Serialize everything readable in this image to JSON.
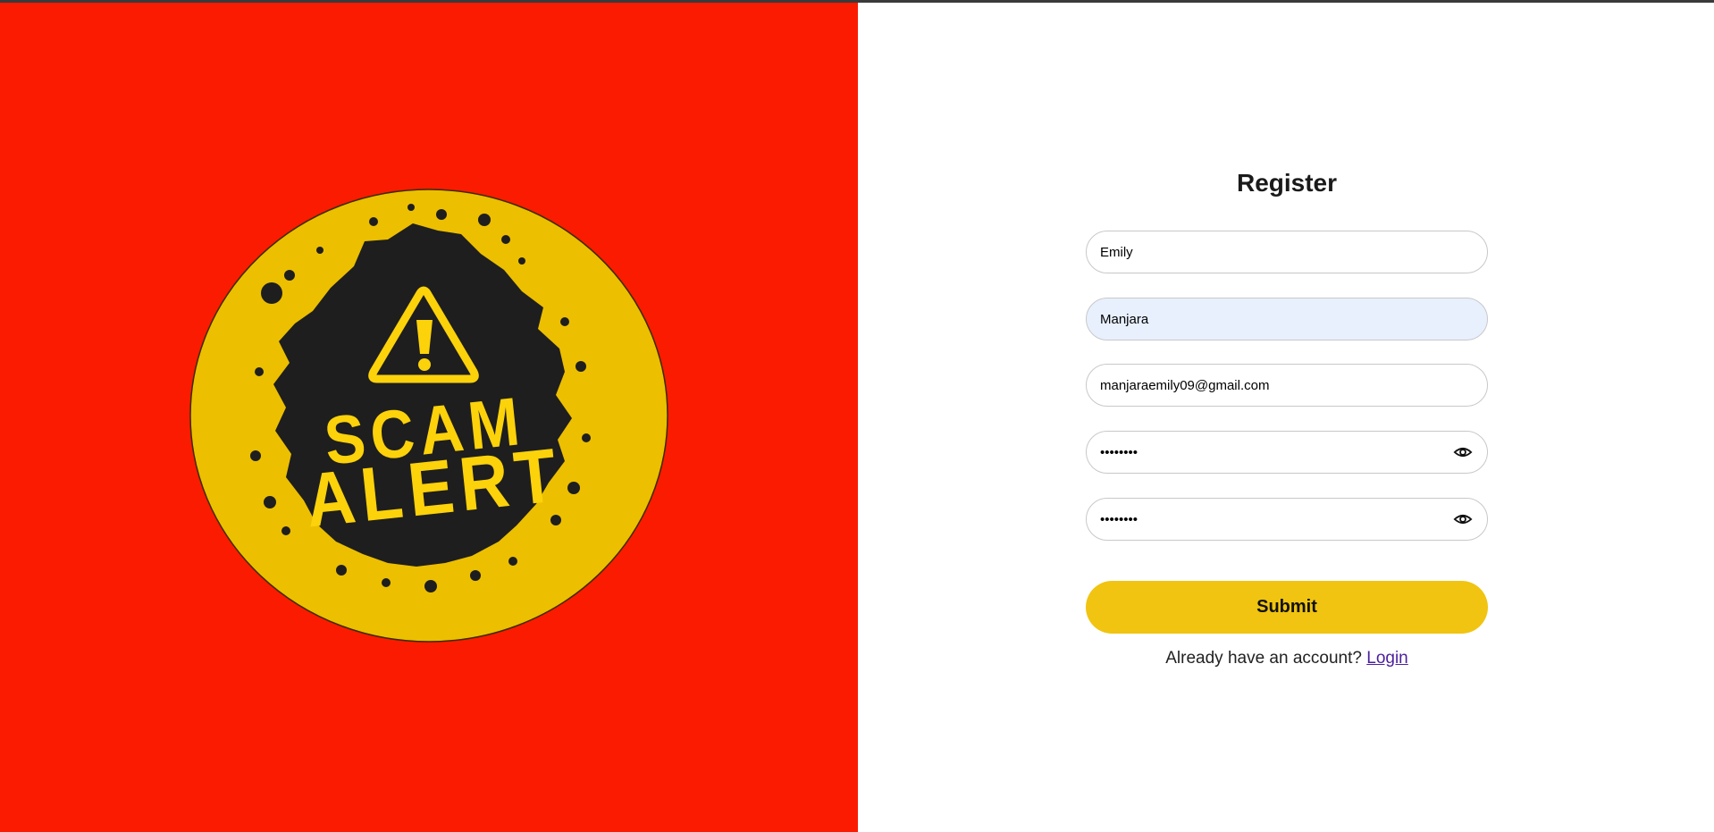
{
  "logo": {
    "line1": "SCAM",
    "line2": "ALERT",
    "circle_color": "#ecbf00",
    "splash_color": "#1e1e1e",
    "text_color": "#fcd20a"
  },
  "colors": {
    "left_bg": "#fb1b00",
    "accent": "#f0c411",
    "link": "#4b1f9e"
  },
  "form": {
    "title": "Register",
    "first_name": "Emily",
    "last_name": "Manjara",
    "email": "manjaraemily09@gmail.com",
    "password": "••••••••",
    "confirm_password": "••••••••",
    "submit_label": "Submit",
    "footer_text": "Already have an account?",
    "login_label": "Login"
  },
  "icons": {
    "password_toggle": "eye-icon",
    "logo_symbol": "warning-triangle-icon"
  }
}
